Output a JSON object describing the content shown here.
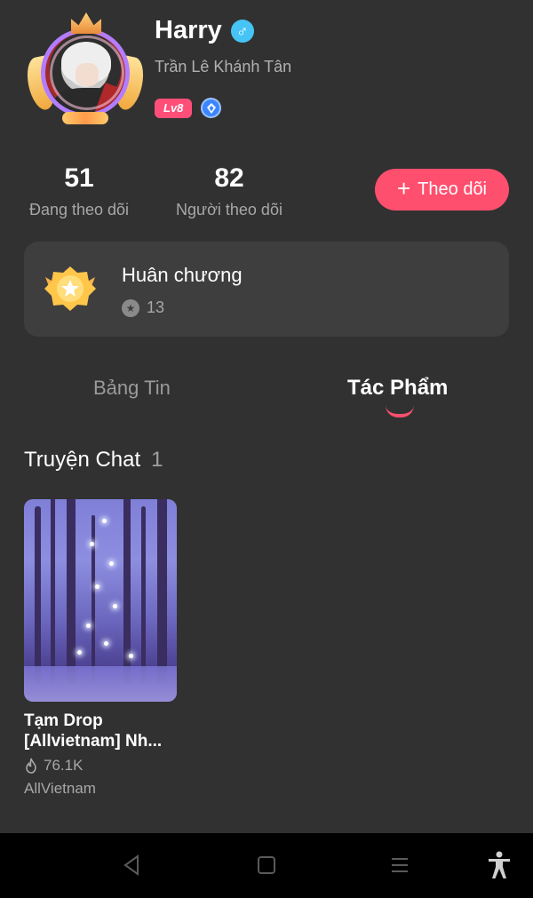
{
  "profile": {
    "display_name": "Harry",
    "gender_symbol": "♂",
    "real_name": "Trần Lê Khánh Tân",
    "level_badge": "Lv8"
  },
  "stats": {
    "following_count": "51",
    "following_label": "Đang theo dõi",
    "followers_count": "82",
    "followers_label": "Người theo dõi"
  },
  "follow_button": {
    "plus": "+",
    "label": "Theo dõi"
  },
  "medals": {
    "title": "Huân chương",
    "count": "13"
  },
  "tabs": [
    {
      "label": "Bảng Tin",
      "active": false
    },
    {
      "label": "Tác Phẩm",
      "active": true
    }
  ],
  "section": {
    "title": "Truyện Chat",
    "count": "1"
  },
  "stories": [
    {
      "title": "Tạm Drop [Allvietnam] Nh...",
      "views": "76.1K",
      "author": "AllVietnam"
    }
  ],
  "colors": {
    "background": "#313131",
    "accent": "#ff4f6e",
    "card": "#3e3e3e",
    "muted_text": "#a7a7a7",
    "gender_icon": "#46c4f5",
    "level_badge": "#ff4f79"
  },
  "icons": [
    "gender-male-icon",
    "gem-icon",
    "medal-icon",
    "star-icon",
    "fire-icon",
    "back-icon",
    "home-icon",
    "recent-apps-icon",
    "accessibility-icon"
  ]
}
